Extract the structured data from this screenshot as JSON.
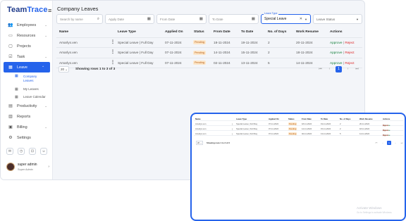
{
  "app": {
    "logo_main": "Team",
    "logo_accent": "Trace"
  },
  "sidebar": {
    "items": [
      {
        "label": "Employees",
        "icon": "users-icon"
      },
      {
        "label": "Resources",
        "icon": "folder-icon"
      },
      {
        "label": "Projects",
        "icon": "projects-icon"
      },
      {
        "label": "Task",
        "icon": "task-icon"
      },
      {
        "label": "Leave",
        "icon": "calendar-icon"
      },
      {
        "label": "Productivity",
        "icon": "productivity-icon"
      },
      {
        "label": "Reports",
        "icon": "reports-icon"
      },
      {
        "label": "Billing",
        "icon": "billing-icon"
      },
      {
        "label": "Settings",
        "icon": "gear-icon"
      }
    ],
    "leave_sub": [
      "Company Leaves",
      "My Leaves",
      "Leave Calendar"
    ],
    "user": {
      "name": "super admin",
      "role": "Super Admin"
    }
  },
  "main": {
    "title": "Company Leaves",
    "filters": {
      "search_placeholder": "Search by name",
      "apply_date": "Apply Date",
      "from_date": "From Date",
      "to_date": "To Date",
      "leave_type_label": "Leave Type",
      "leave_type_value": "Special Leave",
      "leave_status": "Leave Status"
    },
    "table": {
      "headers": [
        "Name",
        "Leave Type",
        "Applied On",
        "Status",
        "From Date",
        "To Date",
        "No. of Days",
        "Work Resume",
        "Actions"
      ],
      "rows": [
        {
          "name": "Amarlys.ven",
          "type": "Special Leave | Full Day",
          "applied": "07-11-2024",
          "status": "Pending",
          "from": "18-11-2024",
          "to": "19-11-2024",
          "days": "2",
          "resume": "20-11-2024"
        },
        {
          "name": "Amarlys.ven",
          "type": "Special Leave | Full Day",
          "applied": "07-11-2024",
          "status": "Pending",
          "from": "14-11-2024",
          "to": "15-11-2024",
          "days": "2",
          "resume": "18-11-2024"
        },
        {
          "name": "Amarlys.ven",
          "type": "Special Leave | Full Day",
          "applied": "07-11-2024",
          "status": "Pending",
          "from": "02-11-2024",
          "to": "13-11-2024",
          "days": "5",
          "resume": "14-11-2024"
        }
      ],
      "approve_label": "Approve",
      "reject_label": "Reject",
      "separator": "|"
    },
    "pagination": {
      "per_page": "20",
      "showing": "Showing rows 1 to 3 of 3",
      "current_page": "1"
    }
  },
  "overlay": {
    "watermark_title": "Activate Windows",
    "watermark_sub": "Go to Settings to activate Windows."
  },
  "colors": {
    "accent": "#2563eb",
    "pending_bg": "#fde6c8",
    "approve": "#15803d",
    "reject": "#dc2626"
  }
}
